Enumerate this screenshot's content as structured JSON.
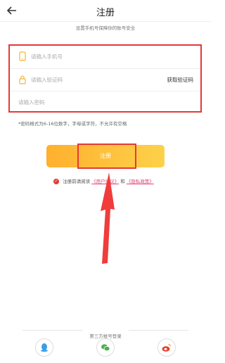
{
  "header": {
    "title": "注册",
    "subtitle": "设置手机号保障你的账号安全"
  },
  "form": {
    "phone_placeholder": "请输入手机号",
    "code_placeholder": "请输入验证码",
    "get_code_label": "获取验证码",
    "password_placeholder": "请输入密码"
  },
  "password_hint": "*密码格式为6-16位数字，字母或字符，不允许有空格",
  "register_label": "注册",
  "agreement": {
    "prefix": "注册前请阅读",
    "user_agreement": "《用户协议》",
    "and": "和",
    "privacy_policy": "《隐私政策》"
  },
  "third_party_label": "第三方帐号登录",
  "colors": {
    "accent": "#e53935",
    "button_start": "#ffb02e",
    "button_end": "#fdd14a"
  },
  "social_icons": [
    "qq-icon",
    "wechat-icon",
    "weibo-icon"
  ]
}
